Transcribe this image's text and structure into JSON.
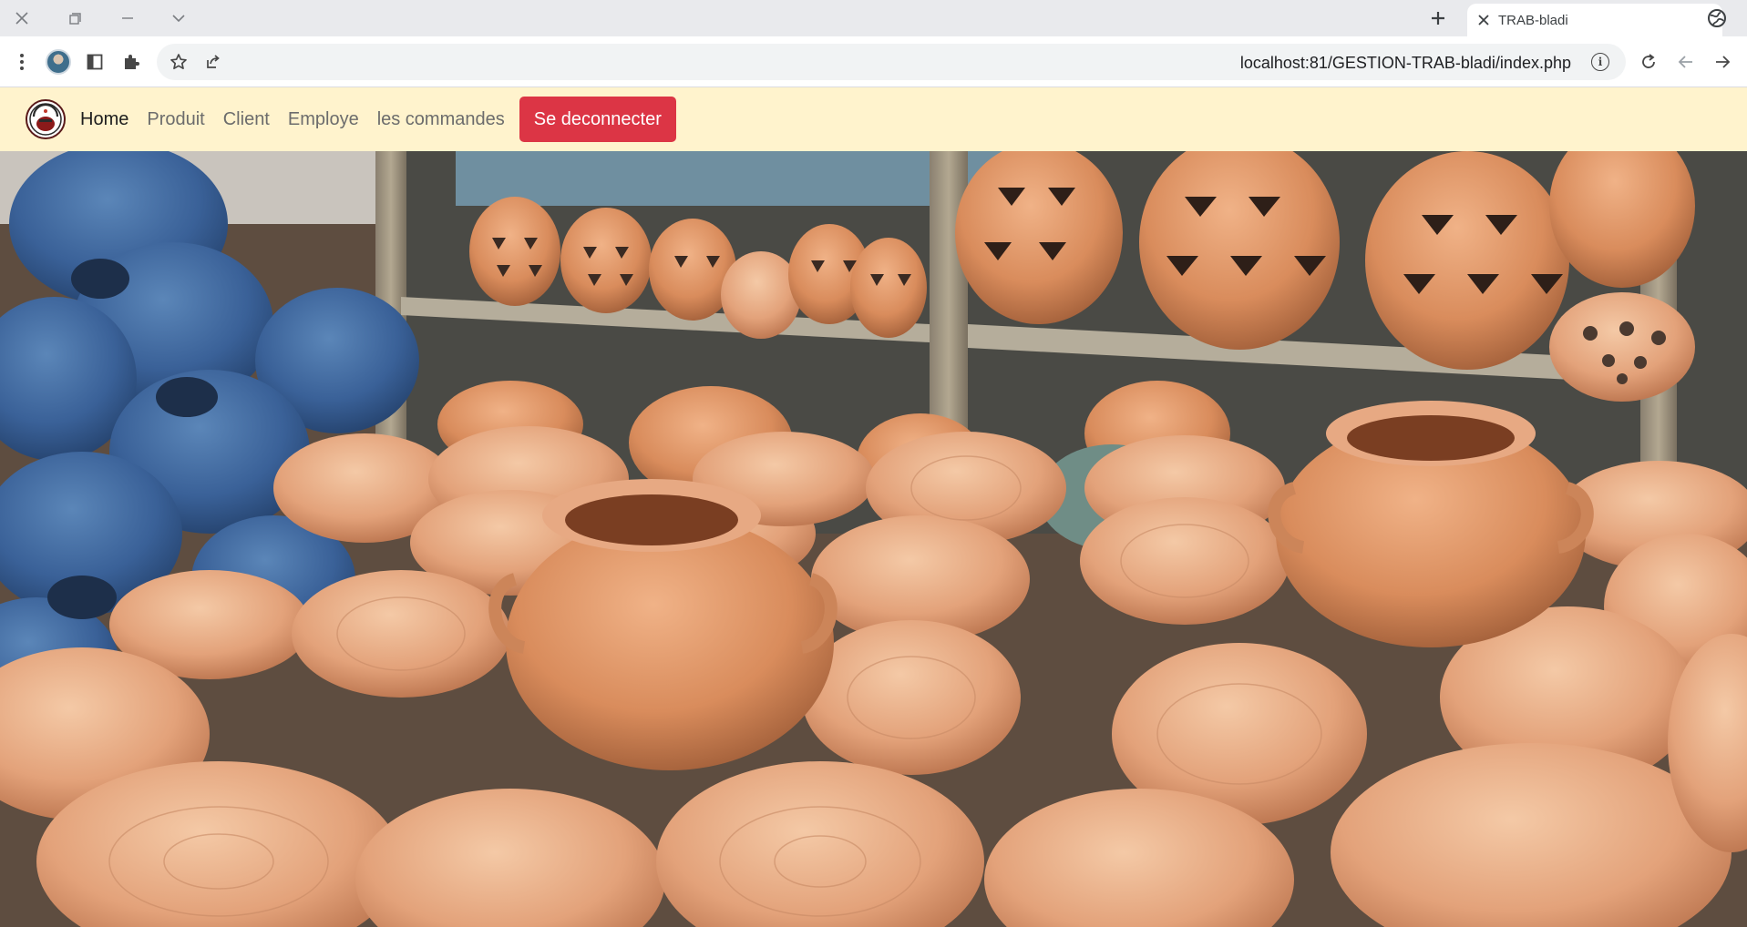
{
  "browser": {
    "tab": {
      "title": "TRAB-bladi"
    },
    "address_bar": {
      "url": "localhost:81/GESTION-TRAB-bladi/index.php"
    },
    "icons": {
      "close_window": "close-icon",
      "restore_window": "restore-icon",
      "minimize_window": "minimize-icon",
      "tab_search": "chevron-down-icon",
      "new_tab": "plus-icon",
      "menu": "kebab-menu-icon",
      "side_panel": "side-panel-icon",
      "extensions": "puzzle-icon",
      "bookmark": "star-icon",
      "share": "share-icon",
      "site_info": "info-icon",
      "reload": "reload-icon",
      "back": "arrow-left-icon",
      "forward": "arrow-right-icon",
      "globe": "globe-icon"
    }
  },
  "navbar": {
    "background": "#fff3cd",
    "links": [
      {
        "label": "Home",
        "active": true
      },
      {
        "label": "Produit",
        "active": false
      },
      {
        "label": "Client",
        "active": false
      },
      {
        "label": "Employe",
        "active": false
      },
      {
        "label": "les commandes",
        "active": false
      }
    ],
    "logout_label": "Se deconnecter",
    "logout_color": "#dc3545"
  },
  "hero": {
    "image": "terracotta pottery market photo"
  }
}
